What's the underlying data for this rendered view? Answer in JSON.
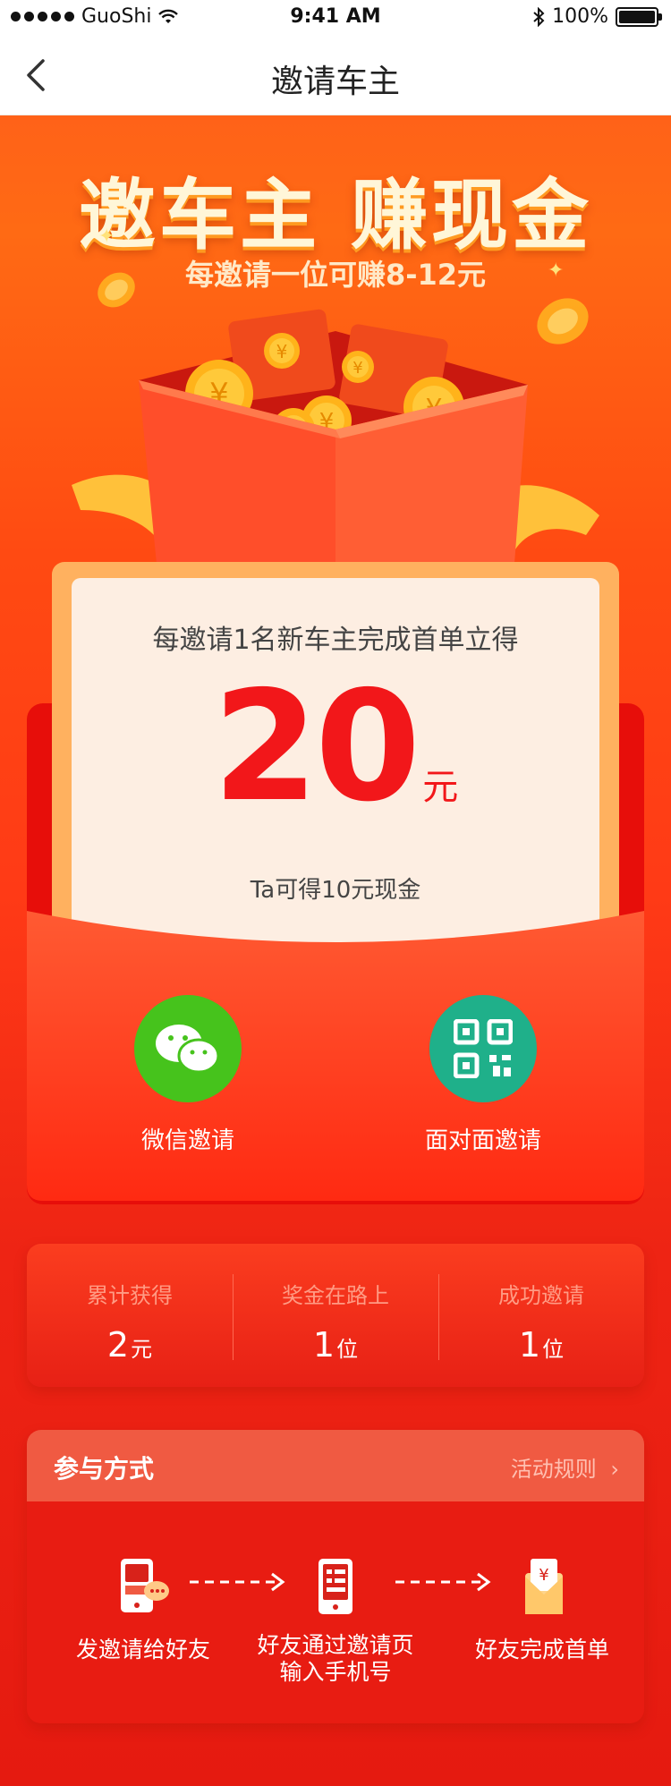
{
  "status_bar": {
    "carrier": "GuoShi",
    "time": "9:41 AM",
    "battery": "100%"
  },
  "nav": {
    "title": "邀请车主"
  },
  "hero": {
    "title": "邀车主  赚现金",
    "subtitle": "每邀请一位可赚8-12元"
  },
  "card": {
    "desc": "每邀请1名新车主完成首单立得",
    "amount": "20",
    "unit": "元",
    "note": "Ta可得10元现金"
  },
  "share": [
    {
      "label": "微信邀请",
      "icon": "wechat-icon"
    },
    {
      "label": "面对面邀请",
      "icon": "qrcode-icon"
    }
  ],
  "stats": [
    {
      "title": "累计获得",
      "value": "2",
      "unit": "元"
    },
    {
      "title": "奖金在路上",
      "value": "1",
      "unit": "位"
    },
    {
      "title": "成功邀请",
      "value": "1",
      "unit": "位"
    }
  ],
  "participate": {
    "title": "参与方式",
    "rules_link": "活动规则",
    "steps": [
      {
        "label": "发邀请给好友",
        "icon": "phone-chat-icon"
      },
      {
        "label": "好友通过邀请页\n输入手机号",
        "icon": "phone-form-icon"
      },
      {
        "label": "好友完成首单",
        "icon": "red-envelope-icon"
      }
    ]
  },
  "colors": {
    "primary": "#ff3a12",
    "amount": "#f2171a",
    "wechat": "#46c31c",
    "qrcode": "#1fb08a"
  }
}
